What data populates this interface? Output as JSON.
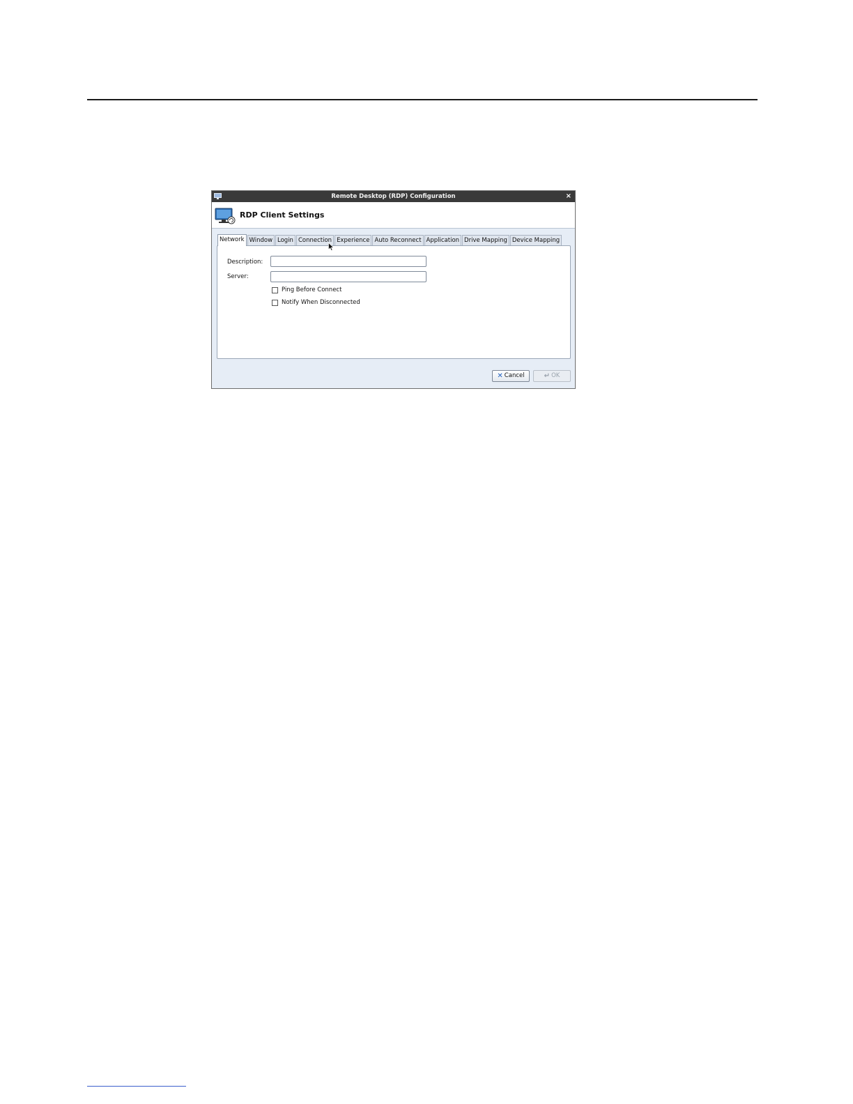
{
  "window": {
    "title": "Remote Desktop (RDP) Configuration",
    "close_glyph": "×",
    "header_title": "RDP Client Settings"
  },
  "tabs": [
    {
      "label": "Network",
      "active": true
    },
    {
      "label": "Window",
      "active": false
    },
    {
      "label": "Login",
      "active": false
    },
    {
      "label": "Connection",
      "active": false
    },
    {
      "label": "Experience",
      "active": false
    },
    {
      "label": "Auto Reconnect",
      "active": false
    },
    {
      "label": "Application",
      "active": false
    },
    {
      "label": "Drive Mapping",
      "active": false
    },
    {
      "label": "Device Mapping",
      "active": false
    }
  ],
  "network": {
    "description_label": "Description:",
    "description_value": "",
    "server_label": "Server:",
    "server_value": "",
    "ping_label": "Ping Before Connect",
    "ping_checked": false,
    "notify_label": "Notify When Disconnected",
    "notify_checked": false
  },
  "buttons": {
    "cancel_label": "Cancel",
    "cancel_icon": "close-icon",
    "ok_label": "OK",
    "ok_icon": "enter-icon",
    "ok_enabled": false
  },
  "colors": {
    "titlebar": "#3a3a3a",
    "dialog_bg": "#e6edf6",
    "accent": "#1f5fbf"
  }
}
